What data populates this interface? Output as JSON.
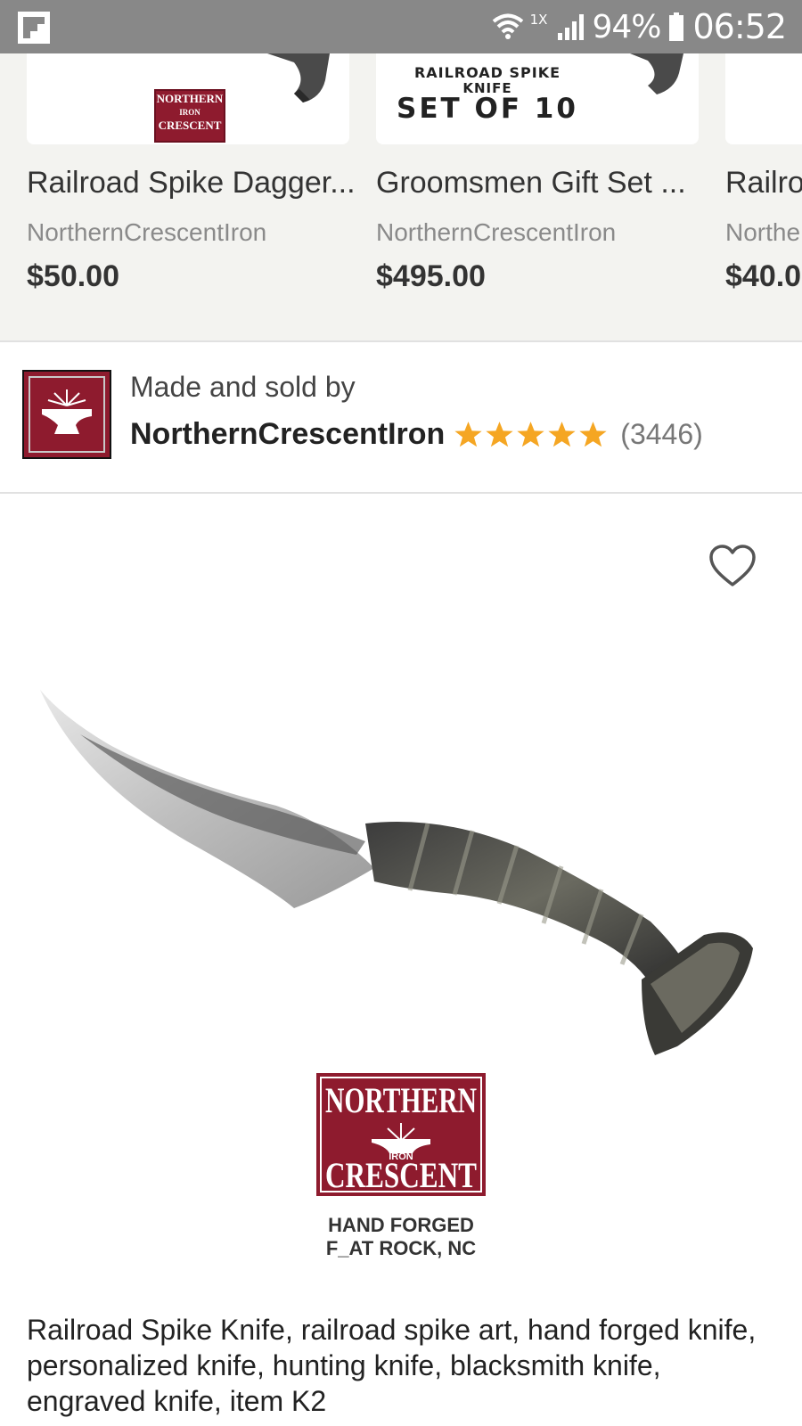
{
  "status_bar": {
    "app_icon": "flipboard-icon",
    "network_label": "1X",
    "battery": "94%",
    "time": "06:52"
  },
  "carousel": {
    "cards": [
      {
        "title": "Railroad Spike Dagger...",
        "shop": "NorthernCrescentIron",
        "price": "$50.00",
        "logo_lines": [
          "NORTHERN",
          "IRON",
          "CRESCENT"
        ]
      },
      {
        "title": "Groomsmen Gift Set ...",
        "shop": "NorthernCrescentIron",
        "price": "$495.00",
        "image_text": [
          "RAILROAD SPIKE",
          "KNIFE",
          "SET OF 10"
        ]
      },
      {
        "title": "Railro",
        "shop": "Northe",
        "price": "$40.0"
      }
    ]
  },
  "seller": {
    "made_by_label": "Made and sold by",
    "name": "NorthernCrescentIron",
    "rating": 5,
    "rating_max": 5,
    "review_count": "(3446)",
    "star_color": "#f5a623"
  },
  "product": {
    "favorite_icon": "heart-outline-icon",
    "logo_lines": [
      "NORTHERN",
      "IRON",
      "CRESCENT"
    ],
    "handforged_line1": "HAND FORGED",
    "handforged_line2": "F_AT ROCK, NC",
    "title": "Railroad Spike Knife, railroad spike art, hand forged knife, personalized knife, hunting knife, blacksmith knife, engraved knife, item K2"
  },
  "colors": {
    "status_bar": "#888888",
    "carousel_bg": "#f3f3f0",
    "brand_red": "#8e1b2e"
  }
}
